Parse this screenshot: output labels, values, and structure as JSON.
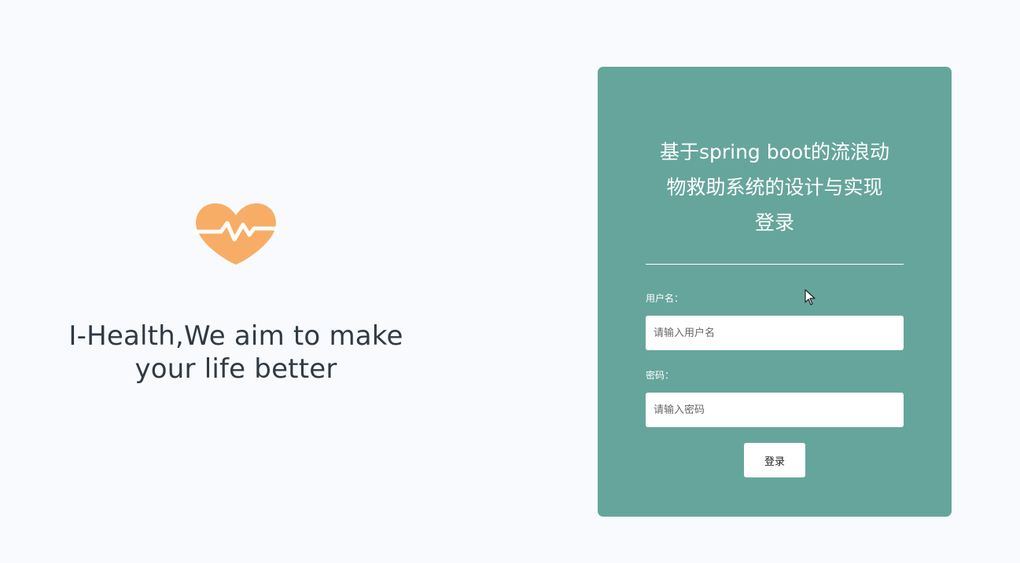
{
  "brand": {
    "logo_icon": "heart-pulse-icon",
    "accent_color": "#f7ad66",
    "slogan_line_1": "I-Health,We aim to make",
    "slogan_line_2": "your life better"
  },
  "login": {
    "title_line_1": "基于spring boot的流浪动",
    "title_line_2": "物救助系统的设计与实现",
    "title_line_3": "登录",
    "username_label": "用户名：",
    "username_value": "",
    "username_placeholder": "请输入用户名",
    "password_label": "密码：",
    "password_value": "",
    "password_placeholder": "请输入密码",
    "submit_label": "登录"
  },
  "theme": {
    "panel_color": "#66a59c",
    "page_background": "#f9fafe"
  }
}
